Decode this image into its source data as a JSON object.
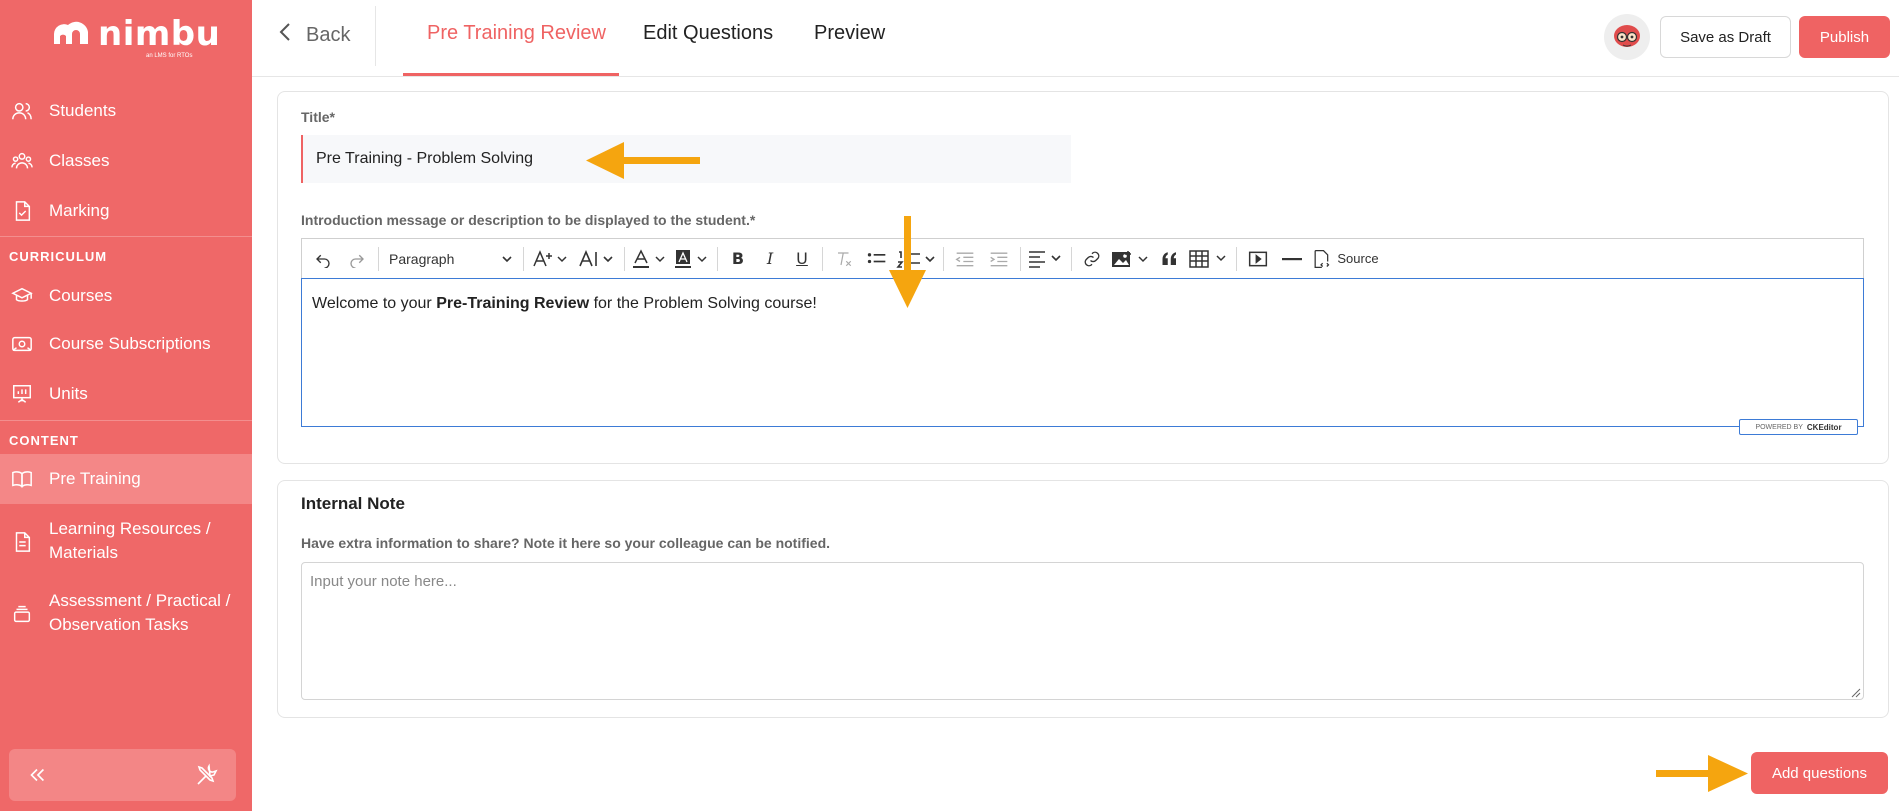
{
  "brand": {
    "name": "nimbu",
    "tagline": "an LMS for RTOs",
    "accent": "#ef6363",
    "sidebar_bg": "#ef6868"
  },
  "sidebar": {
    "items_top": [
      {
        "label": "Students",
        "icon": "users-icon"
      },
      {
        "label": "Classes",
        "icon": "group-icon"
      },
      {
        "label": "Marking",
        "icon": "document-check-icon"
      }
    ],
    "curriculum_label": "CURRICULUM",
    "curriculum_items": [
      {
        "label": "Courses",
        "icon": "graduation-cap-icon"
      },
      {
        "label": "Course Subscriptions",
        "icon": "subscription-icon"
      },
      {
        "label": "Units",
        "icon": "presentation-icon"
      }
    ],
    "content_label": "CONTENT",
    "content_items": [
      {
        "label": "Pre Training",
        "icon": "open-book-icon",
        "active": true
      },
      {
        "label_line1": "Learning Resources /",
        "label_line2": "Materials",
        "icon": "document-icon"
      },
      {
        "label_line1": "Assessment / Practical /",
        "label_line2": "Observation Tasks",
        "icon": "stack-icon"
      }
    ],
    "collapse_icon": "double-chevron-left-icon",
    "tools_icon": "tools-icon"
  },
  "topbar": {
    "back_label": "Back",
    "tabs": [
      {
        "label": "Pre Training Review",
        "active": true
      },
      {
        "label": "Edit Questions"
      },
      {
        "label": "Preview"
      }
    ],
    "save_draft_label": "Save as Draft",
    "publish_label": "Publish"
  },
  "form": {
    "title_label": "Title*",
    "title_value": "Pre Training - Problem Solving",
    "intro_label": "Introduction message or description to be displayed to the student.*",
    "editor": {
      "paragraph_style": "Paragraph",
      "source_label": "Source",
      "content_before": "Welcome to your ",
      "content_bold": "Pre-Training Review",
      "content_after": " for the Problem Solving course!",
      "badge_powered": "POWERED BY",
      "badge_brand": "CKEditor"
    }
  },
  "internal_note": {
    "title": "Internal Note",
    "description": "Have extra information to share? Note it here so your colleague can be notified.",
    "placeholder": "Input your note here..."
  },
  "actions": {
    "add_questions_label": "Add questions"
  },
  "annotation_color": "#f5a50f"
}
